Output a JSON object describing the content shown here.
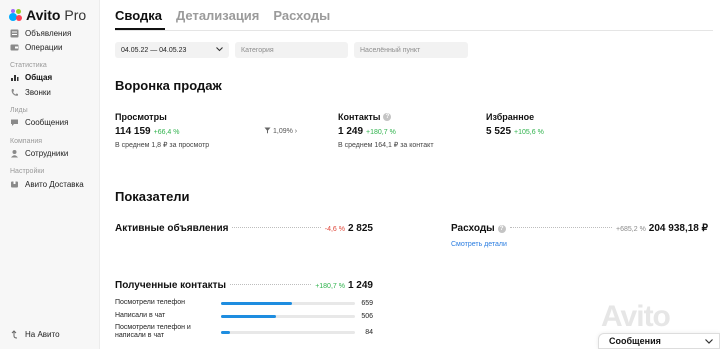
{
  "sidebar": {
    "logo_main": "Avito",
    "logo_sub": " Pro",
    "items": [
      {
        "label": "Объявления",
        "icon": "list-icon"
      },
      {
        "label": "Операции",
        "icon": "wallet-icon"
      }
    ],
    "section_stats": "Статистика",
    "stats_items": [
      {
        "label": "Общая",
        "icon": "chart-icon"
      },
      {
        "label": "Звонки",
        "icon": "phone-icon"
      }
    ],
    "section_leads": "Лиды",
    "leads_items": [
      {
        "label": "Сообщения",
        "icon": "chat-icon"
      }
    ],
    "section_company": "Компания",
    "company_items": [
      {
        "label": "Сотрудники",
        "icon": "users-icon"
      }
    ],
    "section_settings": "Настройки",
    "settings_items": [
      {
        "label": "Авито Доставка",
        "icon": "delivery-icon"
      }
    ],
    "back_label": "На Авито"
  },
  "tabs": [
    "Сводка",
    "Детализация",
    "Расходы"
  ],
  "filters": {
    "date": "04.05.22 — 04.05.23",
    "category_placeholder": "Категория",
    "city_placeholder": "Населённый пункт"
  },
  "funnel": {
    "title": "Воронка продаж",
    "views": {
      "label": "Просмотры",
      "value": "114 159",
      "delta": "+66,4 %",
      "sub": "В среднем 1,8 ₽ за просмотр"
    },
    "conversion": "1,09% ›",
    "contacts": {
      "label": "Контакты",
      "value": "1 249",
      "delta": "+180,7 %",
      "sub": "В среднем 164,1 ₽ за контакт"
    },
    "favorites": {
      "label": "Избранное",
      "value": "5 525",
      "delta": "+105,6 %"
    }
  },
  "indicators": {
    "title": "Показатели",
    "active_ads": {
      "label": "Активные объявления",
      "delta": "-4,6 %",
      "value": "2 825"
    },
    "expenses": {
      "label": "Расходы",
      "delta": "+685,2 %",
      "value": "204 938,18 ₽",
      "link": "Смотреть детали"
    },
    "contacts": {
      "label": "Полученные контакты",
      "delta": "+180,7 %",
      "value": "1 249",
      "rows": [
        {
          "label": "Посмотрели телефон",
          "value": "659",
          "fraction": 0.53
        },
        {
          "label": "Написали в чат",
          "value": "506",
          "fraction": 0.41
        },
        {
          "label": "Посмотрели телефон и написали в чат",
          "value": "84",
          "fraction": 0.07
        }
      ]
    }
  },
  "watermark": "Avito",
  "messages_button": "Сообщения",
  "colors": {
    "accent": "#1e8de0",
    "positive": "#2fb24c",
    "negative": "#e0473a"
  }
}
